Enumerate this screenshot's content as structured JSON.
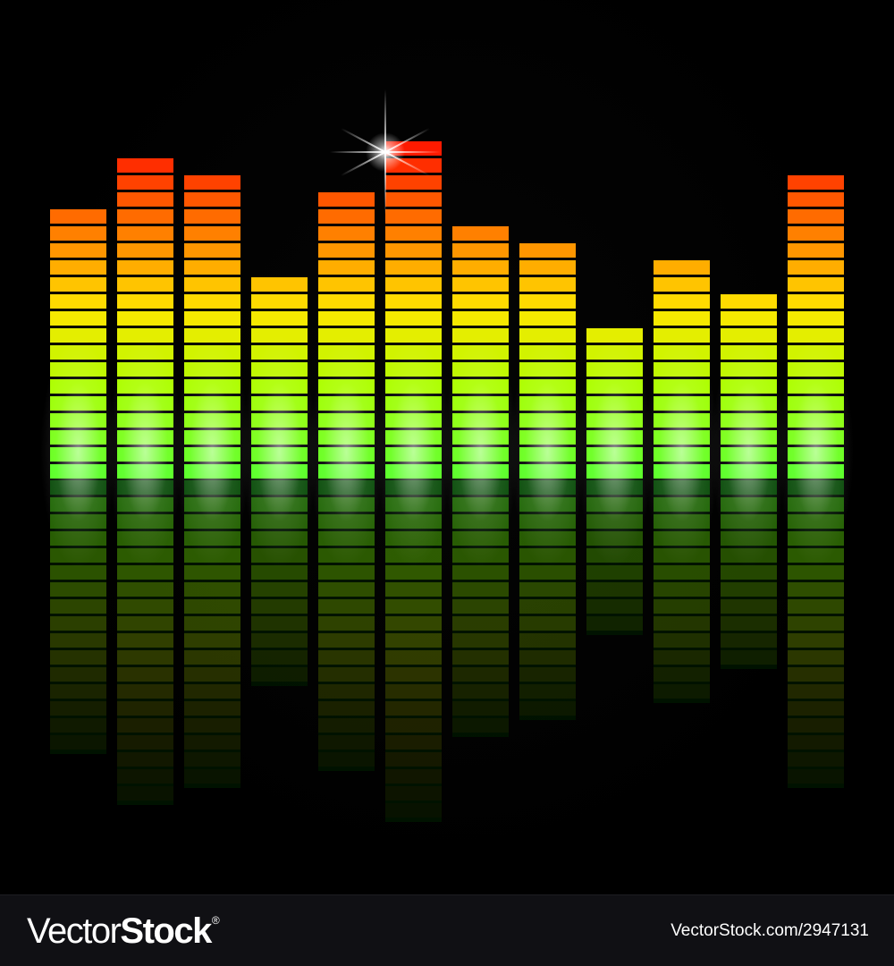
{
  "watermark": {
    "brand_part_1": "Vector",
    "brand_part_2": "Stock",
    "brand_symbol": "®",
    "image_id": "VectorStock.com/2947131"
  },
  "equalizer": {
    "bar_count": 12,
    "levels_in_segments": [
      16,
      19,
      18,
      12,
      17,
      20,
      15,
      14,
      9,
      13,
      11,
      18
    ],
    "max_segments": 20,
    "colors": {
      "top": "#ff1a00",
      "upper": "#ff7a00",
      "middle": "#ffe600",
      "lower": "#a8ff00",
      "bottom": "#55ff20",
      "reflection": "#1aa01a"
    },
    "sparkle_on_bar": 6,
    "background": "#000000"
  }
}
